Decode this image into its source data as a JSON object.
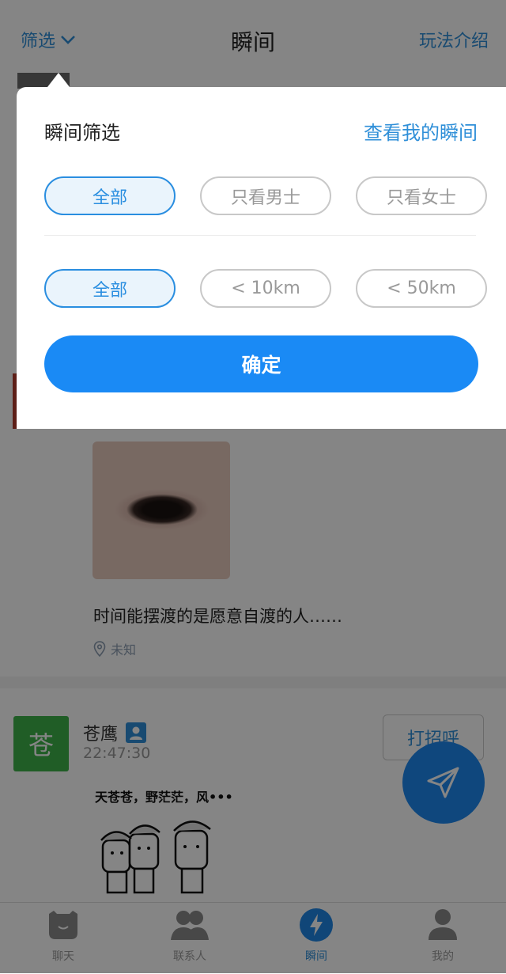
{
  "header": {
    "filter_label": "筛选",
    "title": "瞬间",
    "rules_link": "玩法介绍"
  },
  "feed": {
    "post1": {
      "text": "时间能摆渡的是愿意自渡的人……",
      "location": "未知"
    },
    "post2": {
      "avatar_char": "苍",
      "username": "苍鹰",
      "time": "22:47:30",
      "greet_button": "打招呼",
      "meme_text": "天苍苍，野茫茫，风•••"
    }
  },
  "filter_popup": {
    "title": "瞬间筛选",
    "my_moments_link": "查看我的瞬间",
    "gender_options": [
      "全部",
      "只看男士",
      "只看女士"
    ],
    "gender_selected": 0,
    "distance_options": [
      "全部",
      "< 10km",
      "< 50km"
    ],
    "distance_selected": 0,
    "confirm_label": "确定"
  },
  "tabbar": {
    "items": [
      {
        "label": "聊天",
        "icon": "chat-bubble-icon"
      },
      {
        "label": "联系人",
        "icon": "contacts-icon"
      },
      {
        "label": "瞬间",
        "icon": "lightning-icon"
      },
      {
        "label": "我的",
        "icon": "profile-icon"
      }
    ],
    "active_index": 2
  },
  "colors": {
    "accent": "#1a8af5",
    "link": "#2f8fd8",
    "selected_bg": "#eaf4fc"
  }
}
